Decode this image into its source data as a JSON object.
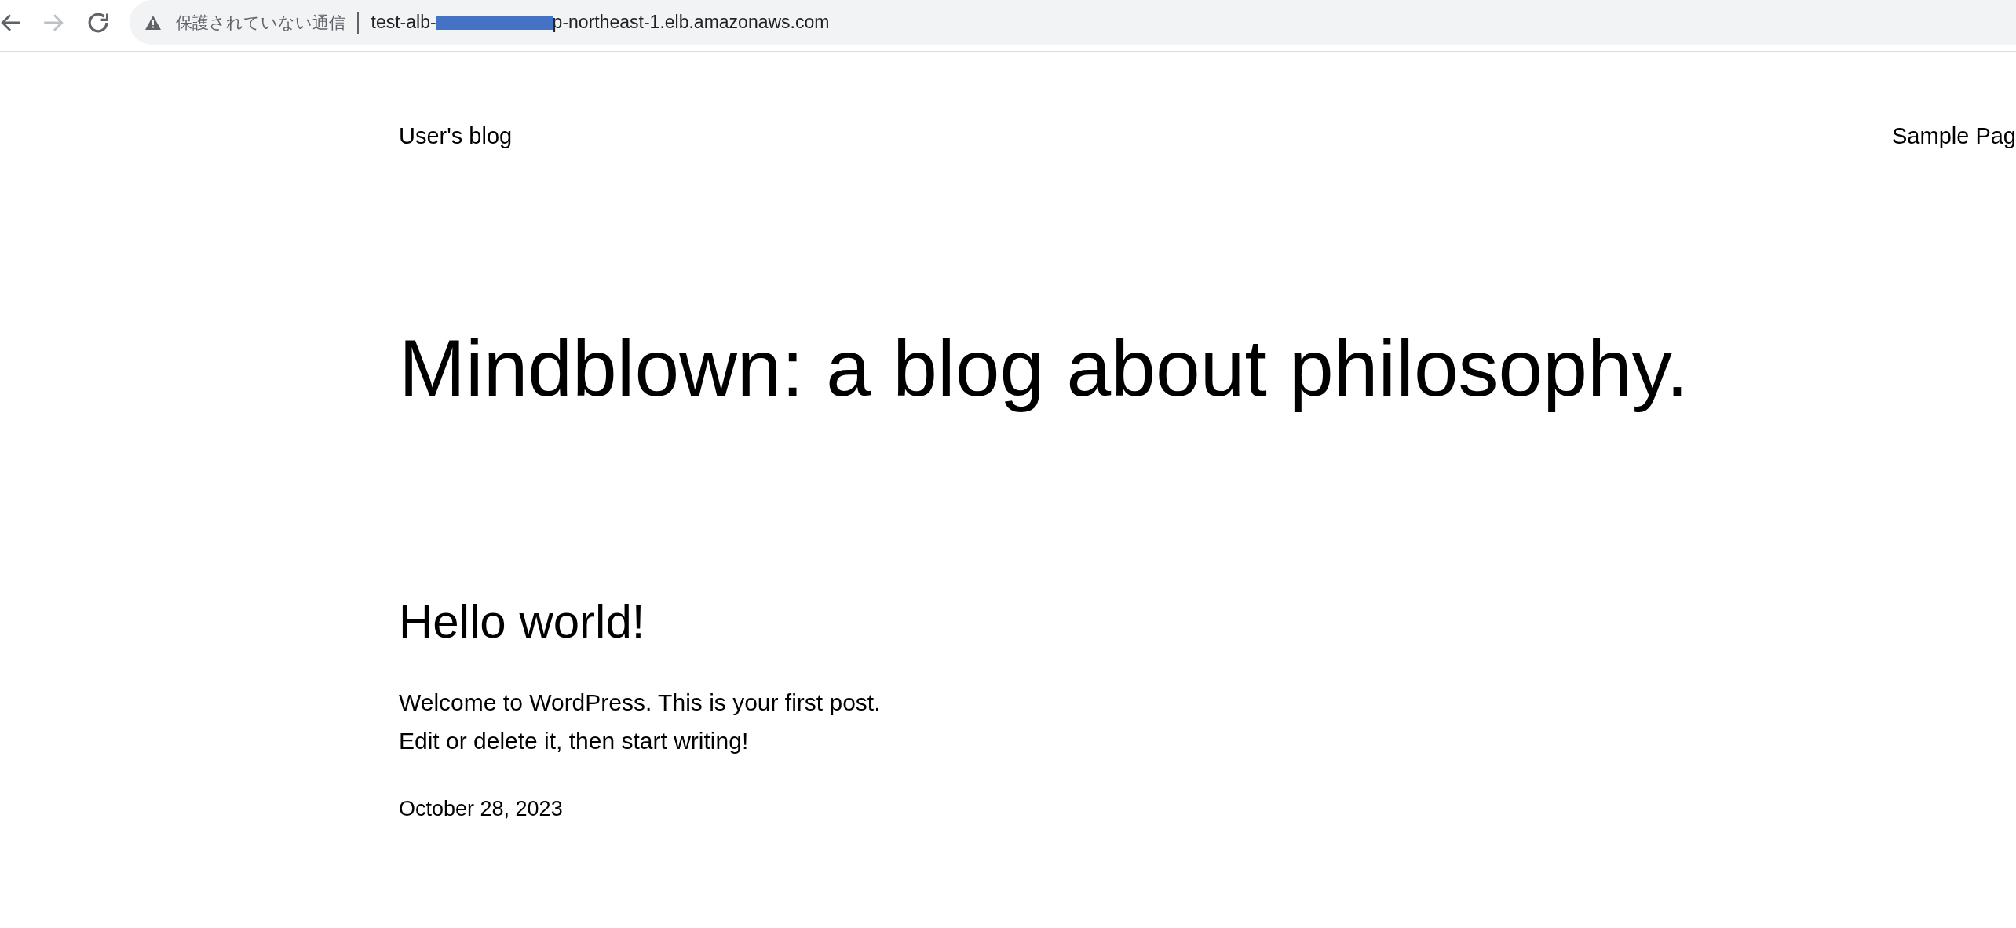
{
  "browser": {
    "nav_buttons": [
      {
        "kind": "back",
        "disabled": false
      },
      {
        "kind": "forward",
        "disabled": true
      },
      {
        "kind": "reload",
        "disabled": false
      }
    ],
    "address_bar": {
      "security_label": "保護されていない通信",
      "url_start": "test-alb-",
      "url_redacted": true,
      "url_end": "p-northeast-1.elb.amazonaws.com"
    }
  },
  "site": {
    "title": "User's blog",
    "nav": [
      {
        "label": "Sample Pag"
      }
    ]
  },
  "heading": "Mindblown: a blog about philosophy.",
  "posts": [
    {
      "title": "Hello world!",
      "excerpt": "Welcome to WordPress. This is your first post.\nEdit or delete it, then start writing!",
      "date": "October 28, 2023"
    }
  ]
}
